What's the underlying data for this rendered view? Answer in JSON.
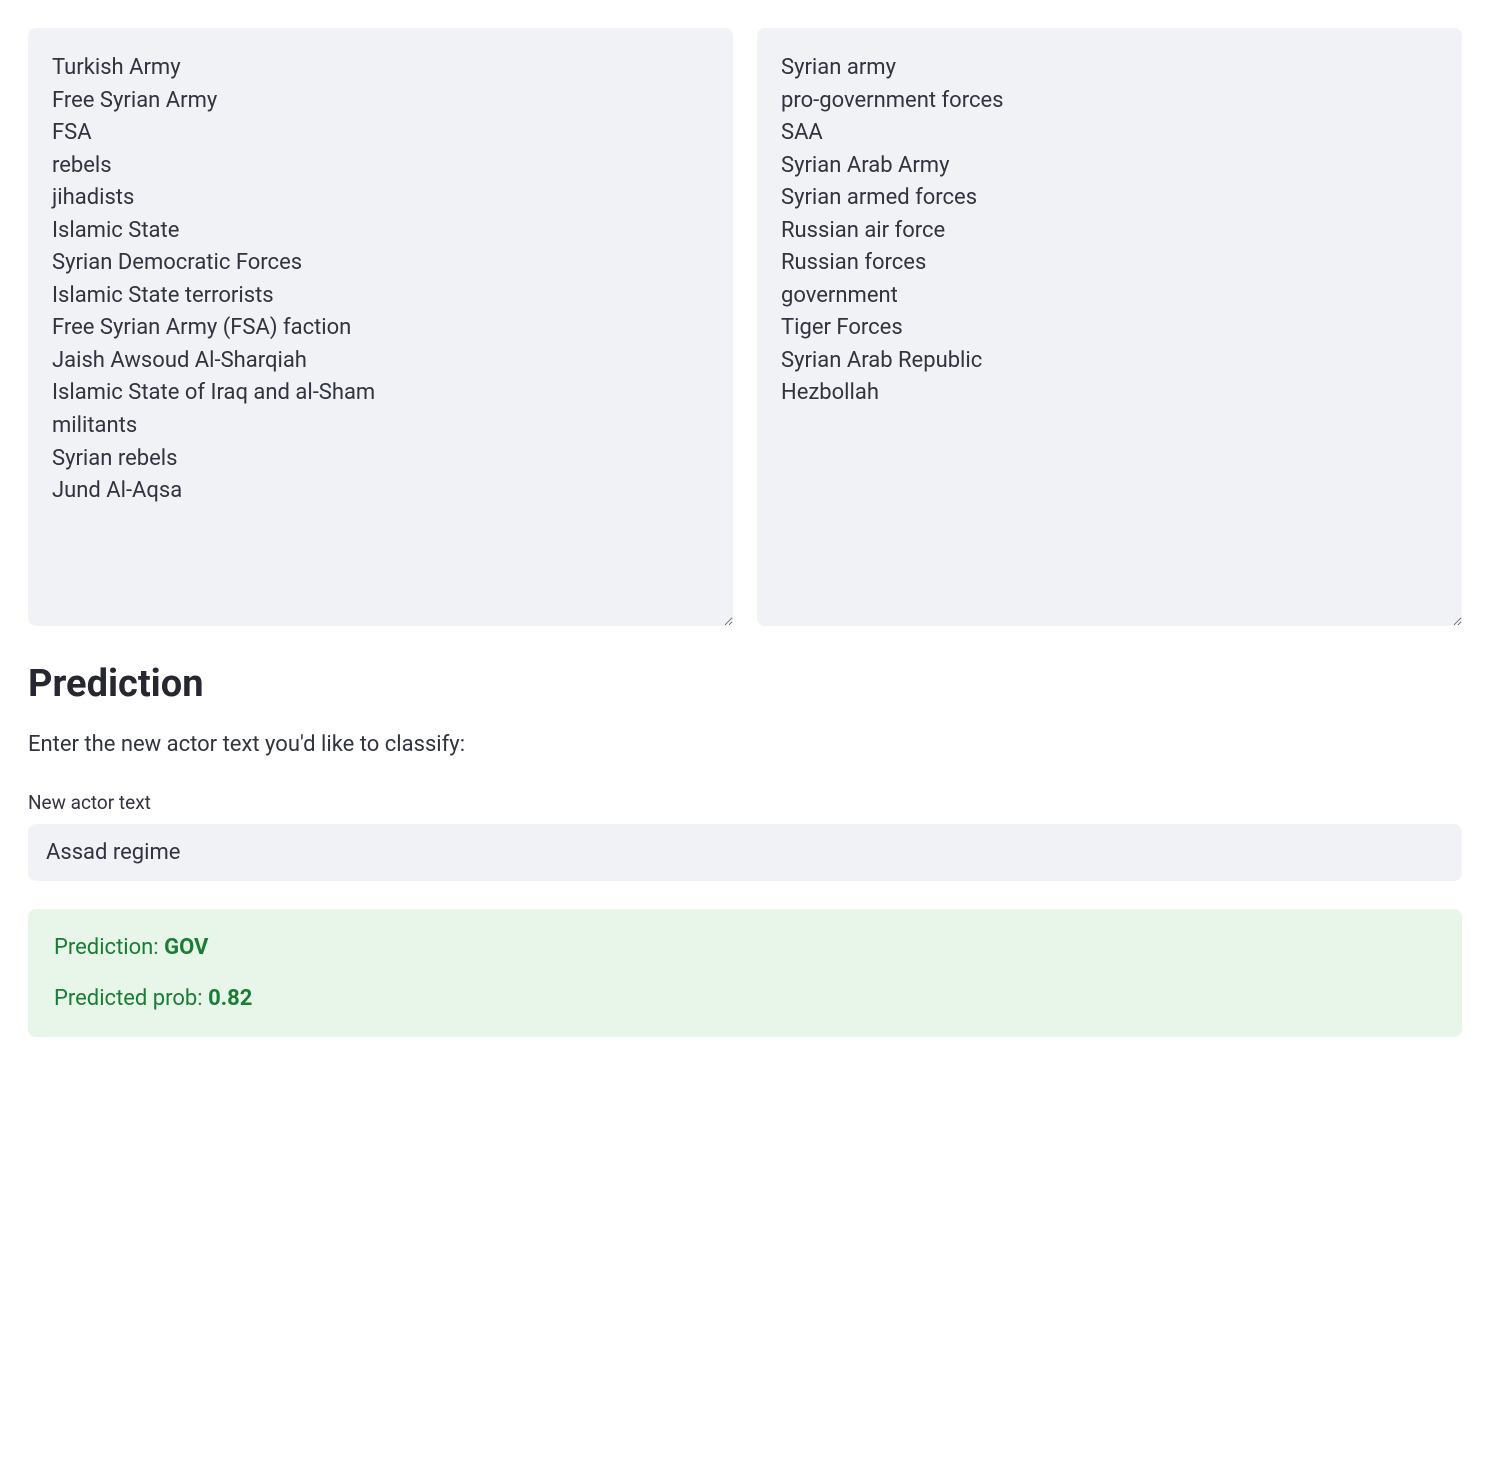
{
  "left_list": "Turkish Army\nFree Syrian Army\nFSA\nrebels\njihadists\nIslamic State\nSyrian Democratic Forces\nIslamic State terrorists\nFree Syrian Army (FSA) faction\nJaish Awsoud Al-Sharqiah\nIslamic State of Iraq and al-Sham\nmilitants\nSyrian rebels\nJund Al-Aqsa",
  "right_list": "Syrian army\npro-government forces\nSAA\nSyrian Arab Army\nSyrian armed forces\nRussian air force\nRussian forces\ngovernment\nTiger Forces\nSyrian Arab Republic\nHezbollah",
  "prediction_heading": "Prediction",
  "instruction_text": "Enter the new actor text you'd like to classify:",
  "input_label": "New actor text",
  "input_value": "Assad regime",
  "result": {
    "pred_label_prefix": "Prediction: ",
    "pred_label_value": "GOV",
    "prob_prefix": "Predicted prob: ",
    "prob_value": "0.82"
  }
}
